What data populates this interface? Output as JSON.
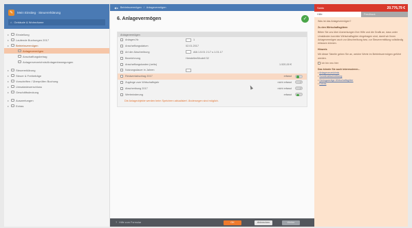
{
  "colors": {
    "brand_blue": "#4a7ab4",
    "accent_orange": "#ef7a2c",
    "selection": "#f6c6a8",
    "success": "#4aa548",
    "header_red": "#d9382c",
    "panel_peach": "#fde3cd"
  },
  "sidebar": {
    "app_title": "Mein Einstieg · Steuererklärung",
    "section": "Gebäude & Wohnräume",
    "items": [
      {
        "label": "Einstellung",
        "state": "normal"
      },
      {
        "label": "Laufende Buchungen 2017",
        "state": "normal"
      },
      {
        "label": "Betriebsvermögen",
        "state": "highlight"
      },
      {
        "label": "Anlagevermögen",
        "state": "active"
      },
      {
        "label": "Anschaffungsbetrag",
        "state": "normal"
      },
      {
        "label": "Anlagenverzeichnis/Anlagenbewegungen",
        "state": "normal"
      },
      {
        "label": "Steuererklärung",
        "state": "normal"
      },
      {
        "label": "Steuer & Freibeträge",
        "state": "normal"
      },
      {
        "label": "Vorschriften / Überprüfen Buchung",
        "state": "normal"
      },
      {
        "label": "Umsatzsteuerschluss",
        "state": "normal"
      },
      {
        "label": "Geschäftsdeckung",
        "state": "normal"
      },
      {
        "label": "Auswertungen",
        "state": "normal"
      },
      {
        "label": "Extras",
        "state": "normal"
      }
    ]
  },
  "main": {
    "breadcrumb": [
      "Betriebsvermögen",
      "Anlagevermögen"
    ],
    "title": "6. Anlagevermögen",
    "form_header": "Anlagevermögen",
    "rows": [
      {
        "label": "Anlagen-Nr.",
        "box": true,
        "value": "1",
        "right": "",
        "toggle": ""
      },
      {
        "label": "Anschaffungsdatum",
        "box": false,
        "value": "02.01.2017",
        "right": "",
        "toggle": ""
      },
      {
        "label": "Art der Abschreibung",
        "box": true,
        "value": "AfA 1.5.01 2.17 u.1.01.17",
        "right": "",
        "toggle": ""
      },
      {
        "label": "Bezeichnung",
        "box": false,
        "value": "Hersteller/Modell 32",
        "right": "",
        "toggle": ""
      },
      {
        "label": "Anschaffungskosten (netto)",
        "box": false,
        "value": "",
        "right": "1.520,00 €",
        "toggle": ""
      },
      {
        "label": "Nutzungsdauer in Jahren",
        "box": true,
        "value": "",
        "right": "",
        "toggle": ""
      },
      {
        "label": "Restwertabschlag 2017",
        "box": false,
        "value": "",
        "right": "erfasst",
        "toggle": "on",
        "highlight": true
      },
      {
        "label": "Zugänge zum Wirtschaftsjahr",
        "box": false,
        "value": "",
        "right": "nicht erfasst",
        "toggle": "edit"
      },
      {
        "label": "Abschreibung 2017",
        "box": false,
        "value": "",
        "right": "nicht erfasst",
        "toggle": "edit"
      },
      {
        "label": "Wertminderung",
        "box": false,
        "value": "",
        "right": "erfasst",
        "toggle": "on"
      }
    ],
    "warning": "Die Anlageobjekte werden beim Speichern aktualisiert. Änderungen sind möglich."
  },
  "footer": {
    "help": "Hilfe zum Formular",
    "primary": "OK",
    "secondary": "Abbrechen",
    "disabled": "Weiter"
  },
  "rpanel": {
    "head_label": "Saldo",
    "price": "20.776,79 €",
    "tabs": [
      "Hilfe",
      "Feedback"
    ],
    "intro": "Was ist das Anlagevermögen?",
    "heading1": "Zu den Wirtschaftsgütern",
    "body1": "Bitten Sie uns über Anmerkungen Ihre Hilfe und die Grafik an, dass unter Umständen korrekte Wirtschaftsgüter eingetragen sind, damit wir Ihnen Anlagevermögen auch zur Abschreibung bzw. zur Steuerermittlung vollständig erfassen können.",
    "heading2": "Hinweis",
    "body2": "Mit dieser Tabelle geben Sie an, welche Werte im Betriebsvermögen geführt werden.",
    "checkbox_label": "Ich bin neu hier",
    "heading3": "Das könnte Sie auch interessieren...",
    "links": [
      "Anlageverzeichnis",
      "Sonderabschreibung",
      "Geringwertige Wirtschaftsgüter",
      "Extras"
    ]
  }
}
